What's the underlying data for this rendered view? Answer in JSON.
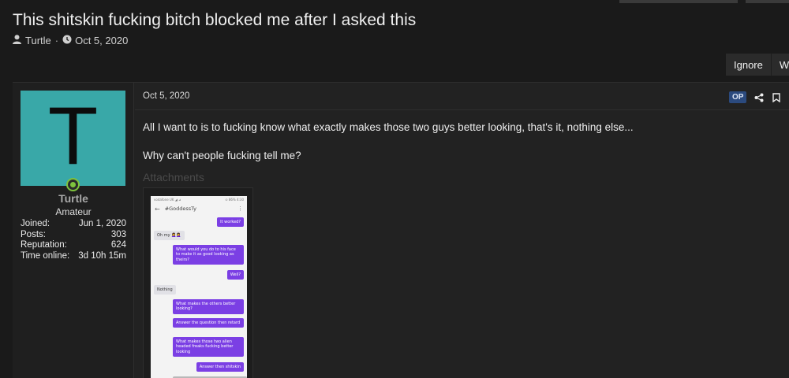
{
  "thread": {
    "title": "This shitskin fucking bitch blocked me after I asked this",
    "author": "Turtle",
    "separator": "·",
    "date": "Oct 5, 2020"
  },
  "buttons": {
    "ignore": "Ignore",
    "watch": "Watch"
  },
  "user": {
    "avatar_letter": "T",
    "avatar_color": "#39a8a8",
    "online_color": "#7ec23d",
    "name": "Turtle",
    "rank": "Amateur",
    "stats": [
      {
        "label": "Joined:",
        "value": "Jun 1, 2020"
      },
      {
        "label": "Posts:",
        "value": "303"
      },
      {
        "label": "Reputation:",
        "value": "624"
      },
      {
        "label": "Time online:",
        "value": "3d 10h 15m"
      }
    ]
  },
  "post": {
    "date": "Oct 5, 2020",
    "op_badge": "OP",
    "paragraphs": [
      "All I want to is to fucking know what exactly makes those two guys better looking, that's it, nothing else...",
      "Why can't people fucking tell me?"
    ],
    "attachments_label": "Attachments"
  },
  "screenshot": {
    "status_left": "vodafone UK  ◢ ⊿",
    "status_right": "⊙ 86% 4:30",
    "chat_name": "#GoddessTy",
    "messages": [
      {
        "from": "me",
        "text": "It worked?"
      },
      {
        "from": "them",
        "text": "Oh my 🤦‍♀️🤦‍♀️"
      },
      {
        "from": "me",
        "text": "What would you do to his face to make it as good looking as theirs?"
      },
      {
        "from": "me",
        "text": "Well?"
      },
      {
        "from": "them",
        "text": "Nothing"
      },
      {
        "from": "me",
        "text": "What makes the others better looking?"
      },
      {
        "from": "me",
        "text": "Answer the question then retard"
      },
      {
        "from": "me",
        "text": "What makes those two alien headed freaks fucking better looking"
      },
      {
        "from": "me",
        "text": "Answer then shitskin"
      }
    ]
  },
  "colors": {
    "background": "#1a1a1a",
    "op_badge": "#2b4a7e",
    "chat_bubble_me": "#7b3fe4"
  }
}
